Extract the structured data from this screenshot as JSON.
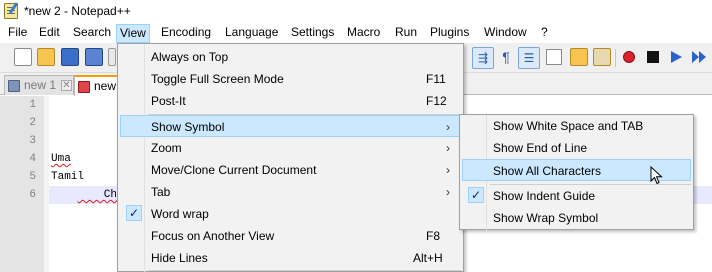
{
  "window": {
    "title": "*new  2 - Notepad++"
  },
  "menubar": {
    "items": [
      {
        "label": "File"
      },
      {
        "label": "Edit"
      },
      {
        "label": "Search"
      },
      {
        "label": "View"
      },
      {
        "label": "Encoding"
      },
      {
        "label": "Language"
      },
      {
        "label": "Settings"
      },
      {
        "label": "Macro"
      },
      {
        "label": "Run"
      },
      {
        "label": "Plugins"
      },
      {
        "label": "Window"
      },
      {
        "label": "?"
      }
    ],
    "active": "View"
  },
  "toolbar": {
    "icons": [
      "new-file-icon",
      "open-file-icon",
      "save-icon",
      "save-all-icon",
      "close-file-icon",
      "wrap-icon",
      "show-all-characters-icon",
      "indent-guide-icon",
      "document-map-icon",
      "function-list-icon",
      "folder-workspace-icon",
      "record-macro-icon",
      "stop-recording-icon",
      "playback-icon",
      "run-multiple-icon"
    ]
  },
  "tabs": [
    {
      "label": "new  1",
      "active": false
    },
    {
      "label": "new ",
      "active": true
    }
  ],
  "editor": {
    "line_numbers": [
      "1",
      "2",
      "3",
      "4",
      "5",
      "6"
    ],
    "lines": [
      "",
      "",
      "",
      "Uma",
      "Tamil",
      "    Chch"
    ],
    "current_line": 6
  },
  "view_menu": {
    "items": [
      {
        "label": "Always on Top",
        "shortcut": ""
      },
      {
        "label": "Toggle Full Screen Mode",
        "shortcut": "F11"
      },
      {
        "label": "Post-It",
        "shortcut": "F12"
      },
      {
        "label": "Show Symbol",
        "shortcut": "",
        "submenu": true,
        "highlighted": true
      },
      {
        "label": "Zoom",
        "shortcut": "",
        "submenu": true
      },
      {
        "label": "Move/Clone Current Document",
        "shortcut": "",
        "submenu": true
      },
      {
        "label": "Tab",
        "shortcut": "",
        "submenu": true
      },
      {
        "label": "Word wrap",
        "shortcut": "",
        "checked": true
      },
      {
        "label": "Focus on Another View",
        "shortcut": "F8"
      },
      {
        "label": "Hide Lines",
        "shortcut": "Alt+H"
      }
    ]
  },
  "show_symbol_menu": {
    "items": [
      {
        "label": "Show White Space and TAB"
      },
      {
        "label": "Show End of Line"
      },
      {
        "label": "Show All Characters",
        "highlighted": true
      },
      {
        "label": "Show Indent Guide",
        "checked": true
      },
      {
        "label": "Show Wrap Symbol"
      }
    ]
  },
  "colors": {
    "menu_highlight": "#cce8ff",
    "menu_highlight_border": "#99d1ff",
    "active_tab_accent": "#f0a000",
    "current_line": "#e8e8ff"
  }
}
